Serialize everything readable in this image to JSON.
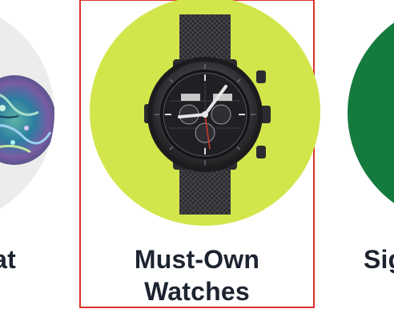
{
  "carousel": {
    "cards": [
      {
        "id": "left",
        "title": "at",
        "circle_color": "#ececec",
        "product_icon": "abalone-shell-icon"
      },
      {
        "id": "center",
        "title": "Must-Own\nWatches",
        "circle_color": "#d2e64b",
        "product_icon": "chronograph-watch-icon",
        "focused": true,
        "focus_color": "#d9322b"
      },
      {
        "id": "right",
        "title": "Sig",
        "circle_color": "#157a3d",
        "product_icon": "category-image-icon"
      }
    ]
  }
}
